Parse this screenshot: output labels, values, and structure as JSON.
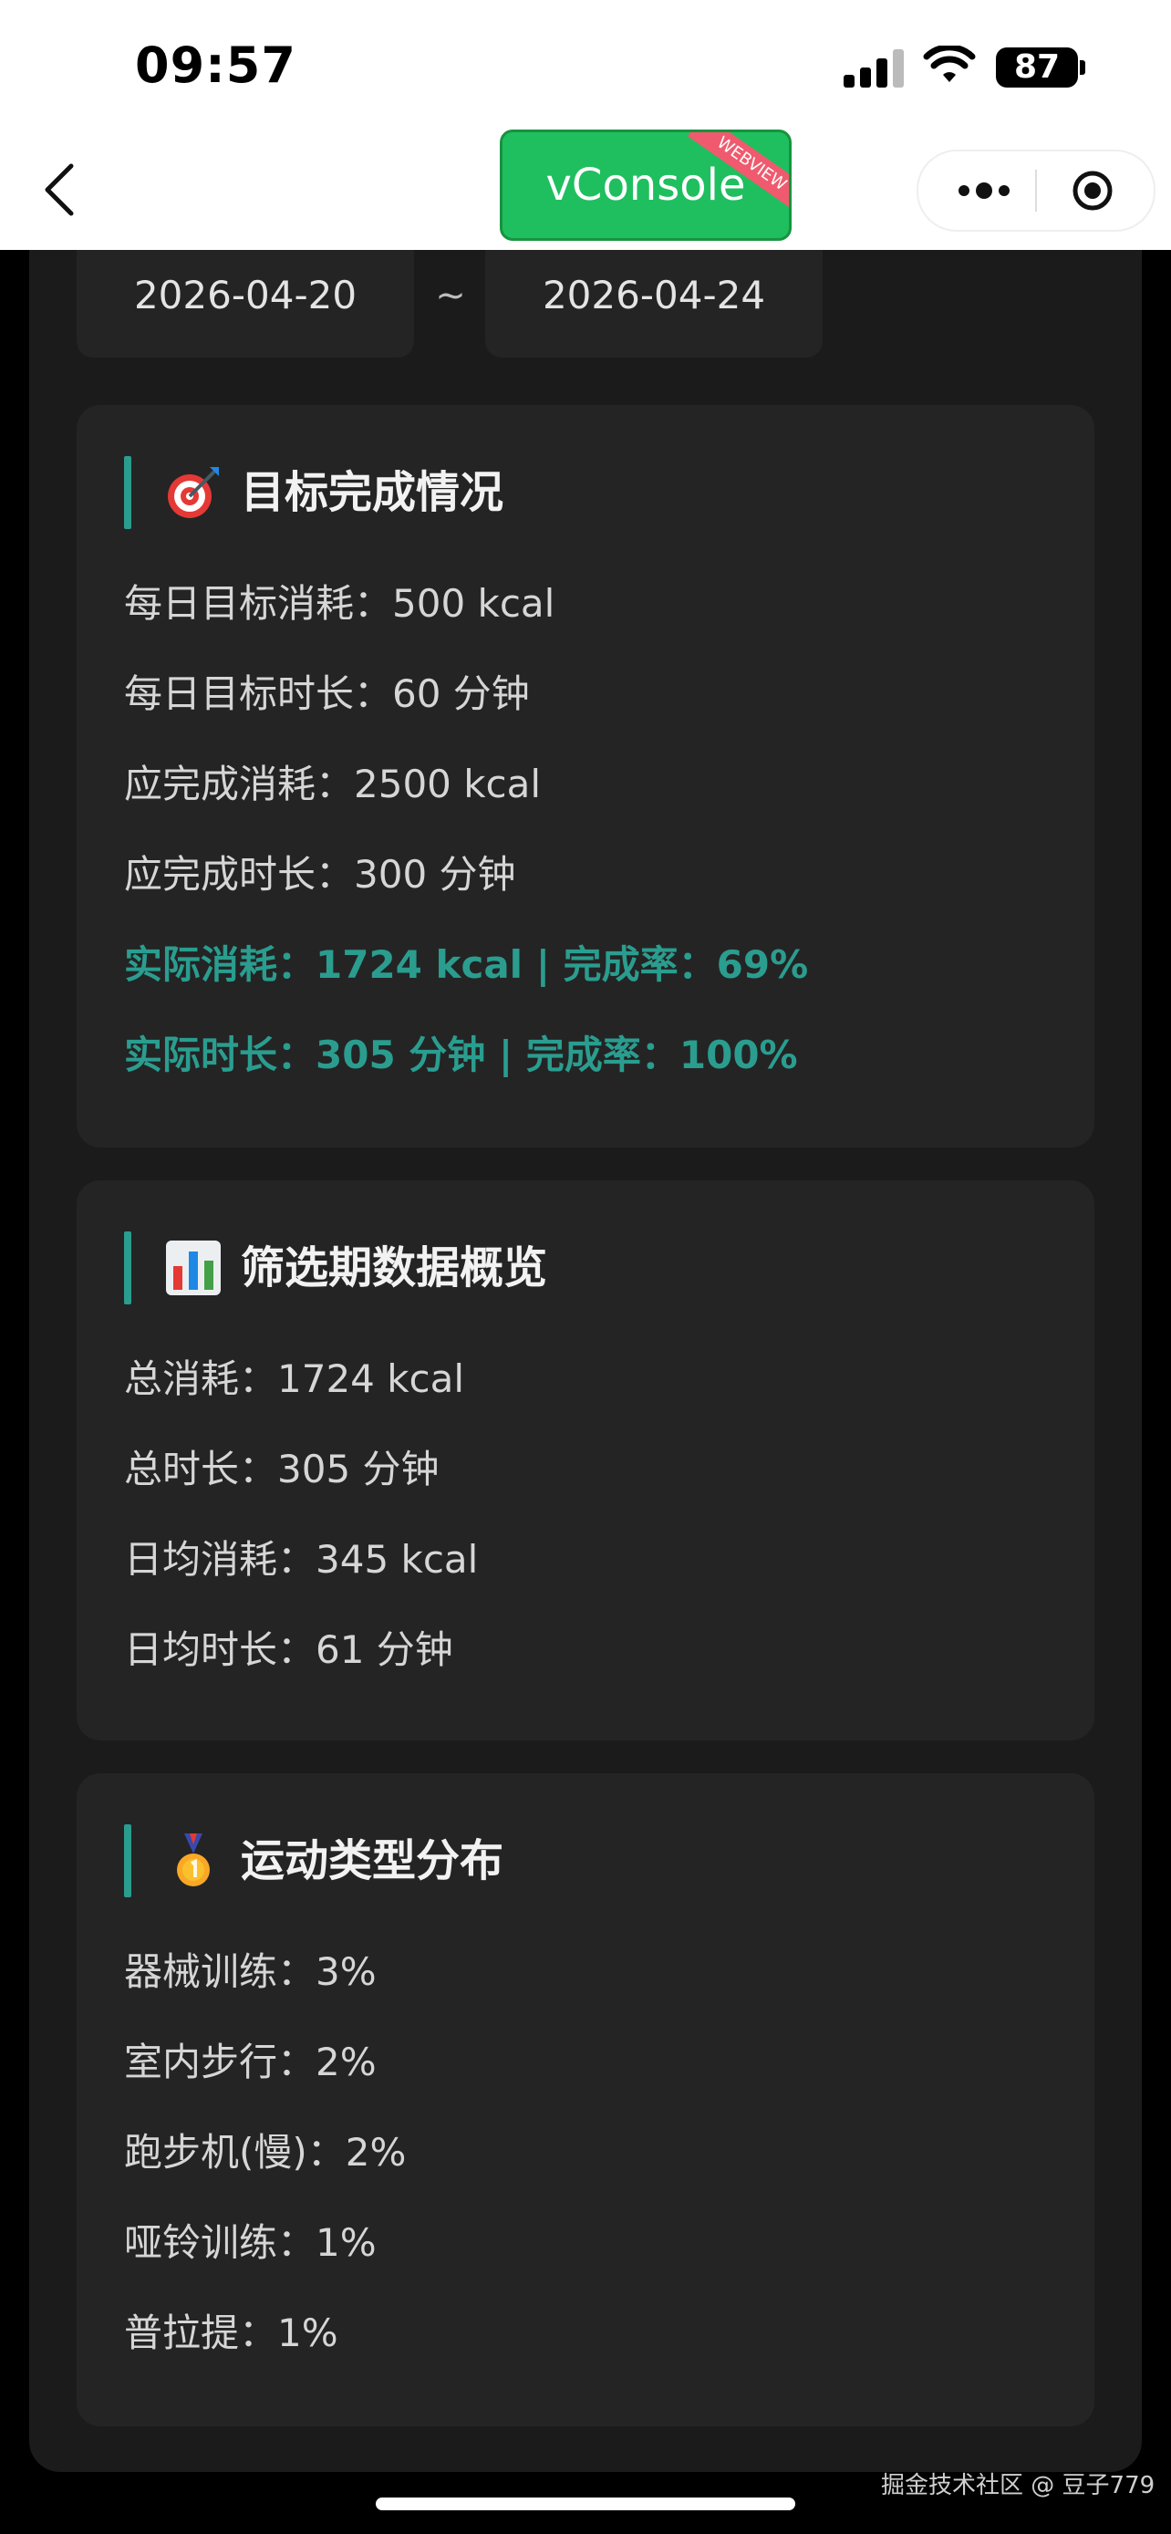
{
  "status_bar": {
    "time": "09:57",
    "battery": "87"
  },
  "nav": {
    "vconsole_label": "vConsole",
    "vconsole_badge": "WEBVIEW"
  },
  "date_range": {
    "start": "2026-04-20",
    "separator": "~",
    "end": "2026-04-24"
  },
  "cards": {
    "goals": {
      "icon": "dart-target-icon",
      "title": "目标完成情况",
      "rows": [
        "每日目标消耗：500 kcal",
        "每日目标时长：60 分钟",
        "应完成消耗：2500 kcal",
        "应完成时长：300 分钟",
        "实际消耗：1724 kcal | 完成率：69%",
        "实际时长：305 分钟 | 完成率：100%"
      ]
    },
    "overview": {
      "icon": "bar-chart-icon",
      "title": "筛选期数据概览",
      "rows": [
        "总消耗：1724 kcal",
        "总时长：305 分钟",
        "日均消耗：345 kcal",
        "日均时长：61 分钟"
      ]
    },
    "distribution": {
      "icon": "medal-icon",
      "title": "运动类型分布",
      "rows": [
        "器械训练：3%",
        "室内步行：2%",
        "跑步机(慢)：2%",
        "哑铃训练：1%",
        "普拉提：1%"
      ]
    }
  },
  "watermark": "掘金技术社区 @ 豆子779",
  "colors": {
    "accent": "#2a9d8f",
    "card_bg": "#242424",
    "container_bg": "#1b1b1b",
    "vconsole_green": "#1fbf5f"
  }
}
